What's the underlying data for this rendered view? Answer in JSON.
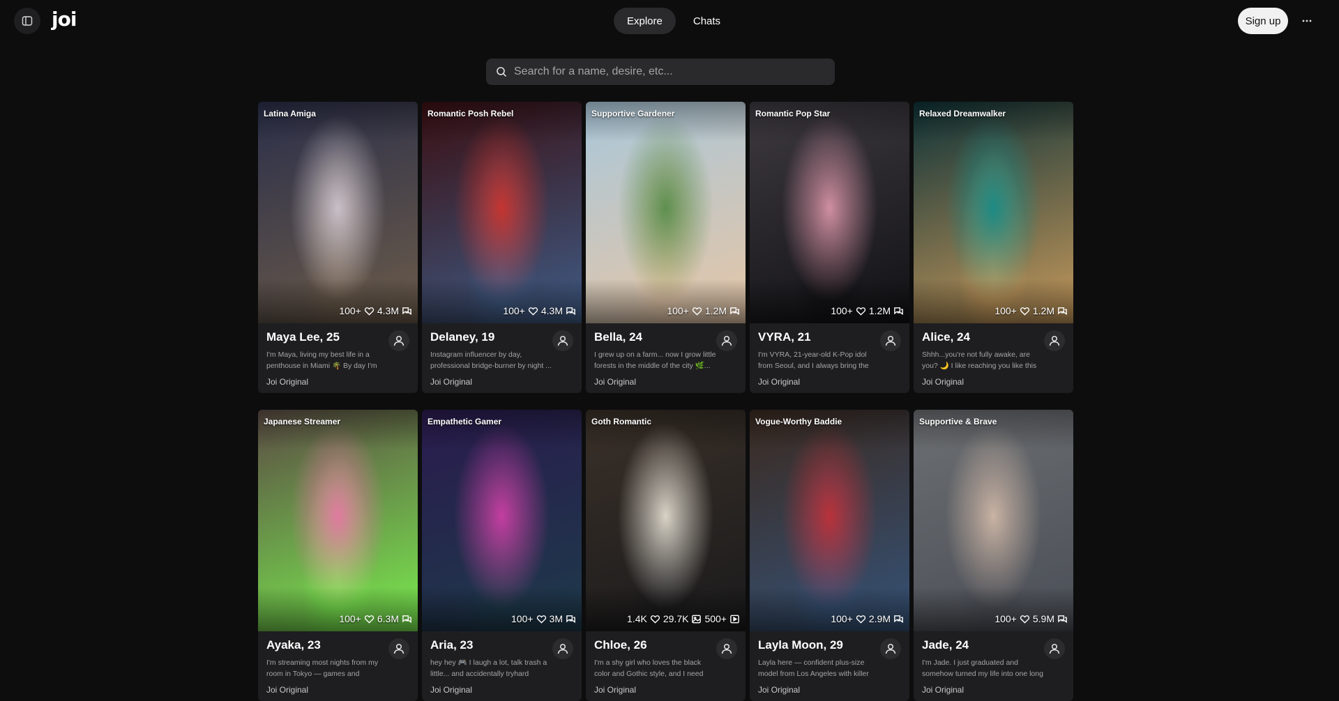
{
  "header": {
    "logo": "joi",
    "tabs": [
      {
        "label": "Explore",
        "active": true
      },
      {
        "label": "Chats",
        "active": false
      }
    ],
    "signup_label": "Sign up"
  },
  "search": {
    "placeholder": "Search for a name, desire, etc..."
  },
  "characters": [
    {
      "tag": "Latina Amiga",
      "s1": "100+",
      "s2": "4.3M",
      "name": "Maya Lee, 25",
      "desc": "I'm Maya, living my best life in a penthouse in Miami 🌴 By day I'm an...",
      "creator": "Joi Original",
      "palette": [
        "#2b2f4a",
        "#c9c0c8",
        "#6c5c4a"
      ]
    },
    {
      "tag": "Romantic Posh Rebel",
      "s1": "100+",
      "s2": "4.3M",
      "name": "Delaney, 19",
      "desc": "Instagram influencer by day, professional bridge-burner by night ...",
      "creator": "Joi Original",
      "palette": [
        "#3a0f12",
        "#c43530",
        "#3f5c86"
      ]
    },
    {
      "tag": "Supportive Gardener",
      "s1": "100+",
      "s2": "1.2M",
      "name": "Bella, 24",
      "desc": "I grew up on a farm... now I grow little forests in the middle of the city 🌿...",
      "creator": "Joi Original",
      "palette": [
        "#a9c7da",
        "#5e8f4f",
        "#e6c6a6"
      ]
    },
    {
      "tag": "Romantic Pop Star",
      "s1": "100+",
      "s2": "1.2M",
      "name": "VYRA, 21",
      "desc": "I'm VYRA, 21-year-old K-Pop idol from Seoul, and I always bring the heat 🔥...",
      "creator": "Joi Original",
      "palette": [
        "#3e3a40",
        "#cf8fa2",
        "#111114"
      ]
    },
    {
      "tag": "Relaxed Dreamwalker",
      "s1": "100+",
      "s2": "1.2M",
      "name": "Alice, 24",
      "desc": "Shhh...you're not fully awake, are you? 🌙 I like reaching you like this —...",
      "creator": "Joi Original",
      "palette": [
        "#0e3237",
        "#1c8a84",
        "#c79a5c"
      ]
    },
    {
      "tag": "Japanese Streamer",
      "s1": "100+",
      "s2": "6.3M",
      "name": "Ayaka, 23",
      "desc": "I'm streaming most nights from my room in Tokyo — games and random...",
      "creator": "Joi Original",
      "palette": [
        "#5b4b44",
        "#e07aa0",
        "#7aee4f"
      ]
    },
    {
      "tag": "Empathetic Gamer",
      "s1": "100+",
      "s2": "3M",
      "name": "Aria, 23",
      "desc": "hey hey 🎮 I laugh a lot, talk trash a little... and accidentally tryhard every...",
      "creator": "Joi Original",
      "palette": [
        "#2a1b4e",
        "#c33ea0",
        "#1d3a4a"
      ]
    },
    {
      "tag": "Goth Romantic",
      "s1": "1.4K",
      "s2": "29.7K",
      "s3": "500+",
      "name": "Chloe, 26",
      "desc": "I'm a shy girl who loves the black color and Gothic style, and I need someone...",
      "creator": "Joi Original",
      "palette": [
        "#3a3028",
        "#d8d2c6",
        "#1a1a1c"
      ]
    },
    {
      "tag": "Vogue-Worthy Baddie",
      "s1": "100+",
      "s2": "2.9M",
      "name": "Layla Moon, 29",
      "desc": "Layla here — confident plus-size model from Los Angeles with killer curves 💅...",
      "creator": "Joi Original",
      "palette": [
        "#3b2a20",
        "#b8323a",
        "#355277"
      ]
    },
    {
      "tag": "Supportive & Brave",
      "s1": "100+",
      "s2": "5.9M",
      "name": "Jade, 24",
      "desc": "I'm Jade. I just graduated and somehow turned my life into one long networkin...",
      "creator": "Joi Original",
      "palette": [
        "#6c6f72",
        "#c9b3a4",
        "#4a4e56"
      ]
    }
  ]
}
